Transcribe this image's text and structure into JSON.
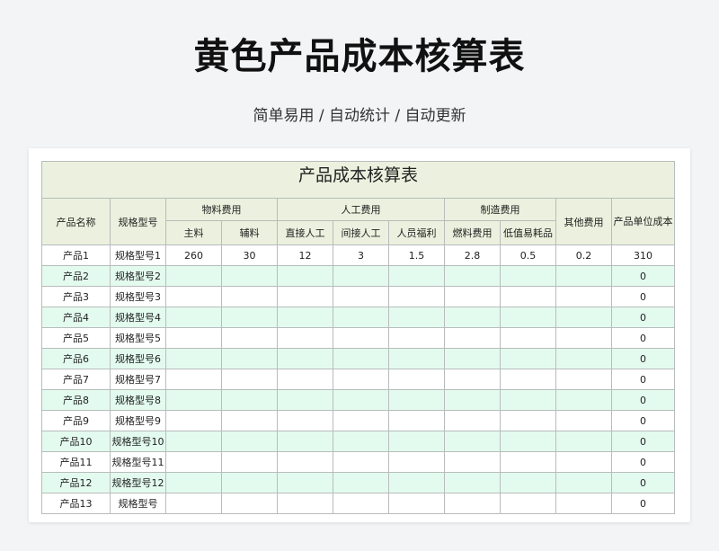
{
  "page": {
    "title": "黄色产品成本核算表",
    "subtitle": "简单易用 / 自动统计 / 自动更新"
  },
  "sheet": {
    "title": "产品成本核算表",
    "headers": {
      "product_name": "产品名称",
      "spec": "规格型号",
      "material_cost": "物料费用",
      "main_material": "主料",
      "aux_material": "辅料",
      "labor_cost": "人工费用",
      "direct_labor": "直接人工",
      "indirect_labor": "间接人工",
      "welfare": "人员福利",
      "manufacturing_cost": "制造费用",
      "fuel": "燃料费用",
      "consumables": "低值易耗品",
      "other_cost": "其他费用",
      "unit_cost": "产品单位成本"
    },
    "rows": [
      {
        "name": "产品1",
        "spec": "规格型号1",
        "main": "260",
        "aux": "30",
        "direct": "12",
        "indirect": "3",
        "welfare": "1.5",
        "fuel": "2.8",
        "consumables": "0.5",
        "other": "0.2",
        "unit_cost": "310"
      },
      {
        "name": "产品2",
        "spec": "规格型号2",
        "main": "",
        "aux": "",
        "direct": "",
        "indirect": "",
        "welfare": "",
        "fuel": "",
        "consumables": "",
        "other": "",
        "unit_cost": "0"
      },
      {
        "name": "产品3",
        "spec": "规格型号3",
        "main": "",
        "aux": "",
        "direct": "",
        "indirect": "",
        "welfare": "",
        "fuel": "",
        "consumables": "",
        "other": "",
        "unit_cost": "0"
      },
      {
        "name": "产品4",
        "spec": "规格型号4",
        "main": "",
        "aux": "",
        "direct": "",
        "indirect": "",
        "welfare": "",
        "fuel": "",
        "consumables": "",
        "other": "",
        "unit_cost": "0"
      },
      {
        "name": "产品5",
        "spec": "规格型号5",
        "main": "",
        "aux": "",
        "direct": "",
        "indirect": "",
        "welfare": "",
        "fuel": "",
        "consumables": "",
        "other": "",
        "unit_cost": "0"
      },
      {
        "name": "产品6",
        "spec": "规格型号6",
        "main": "",
        "aux": "",
        "direct": "",
        "indirect": "",
        "welfare": "",
        "fuel": "",
        "consumables": "",
        "other": "",
        "unit_cost": "0"
      },
      {
        "name": "产品7",
        "spec": "规格型号7",
        "main": "",
        "aux": "",
        "direct": "",
        "indirect": "",
        "welfare": "",
        "fuel": "",
        "consumables": "",
        "other": "",
        "unit_cost": "0"
      },
      {
        "name": "产品8",
        "spec": "规格型号8",
        "main": "",
        "aux": "",
        "direct": "",
        "indirect": "",
        "welfare": "",
        "fuel": "",
        "consumables": "",
        "other": "",
        "unit_cost": "0"
      },
      {
        "name": "产品9",
        "spec": "规格型号9",
        "main": "",
        "aux": "",
        "direct": "",
        "indirect": "",
        "welfare": "",
        "fuel": "",
        "consumables": "",
        "other": "",
        "unit_cost": "0"
      },
      {
        "name": "产品10",
        "spec": "规格型号10",
        "main": "",
        "aux": "",
        "direct": "",
        "indirect": "",
        "welfare": "",
        "fuel": "",
        "consumables": "",
        "other": "",
        "unit_cost": "0"
      },
      {
        "name": "产品11",
        "spec": "规格型号11",
        "main": "",
        "aux": "",
        "direct": "",
        "indirect": "",
        "welfare": "",
        "fuel": "",
        "consumables": "",
        "other": "",
        "unit_cost": "0"
      },
      {
        "name": "产品12",
        "spec": "规格型号12",
        "main": "",
        "aux": "",
        "direct": "",
        "indirect": "",
        "welfare": "",
        "fuel": "",
        "consumables": "",
        "other": "",
        "unit_cost": "0"
      },
      {
        "name": "产品13",
        "spec": "规格型号",
        "main": "",
        "aux": "",
        "direct": "",
        "indirect": "",
        "welfare": "",
        "fuel": "",
        "consumables": "",
        "other": "",
        "unit_cost": "0"
      }
    ],
    "colors": {
      "header_bg": "#ebf1de",
      "stripe_bg": "#e3fbef",
      "page_bg": "#f3f4f6"
    }
  }
}
